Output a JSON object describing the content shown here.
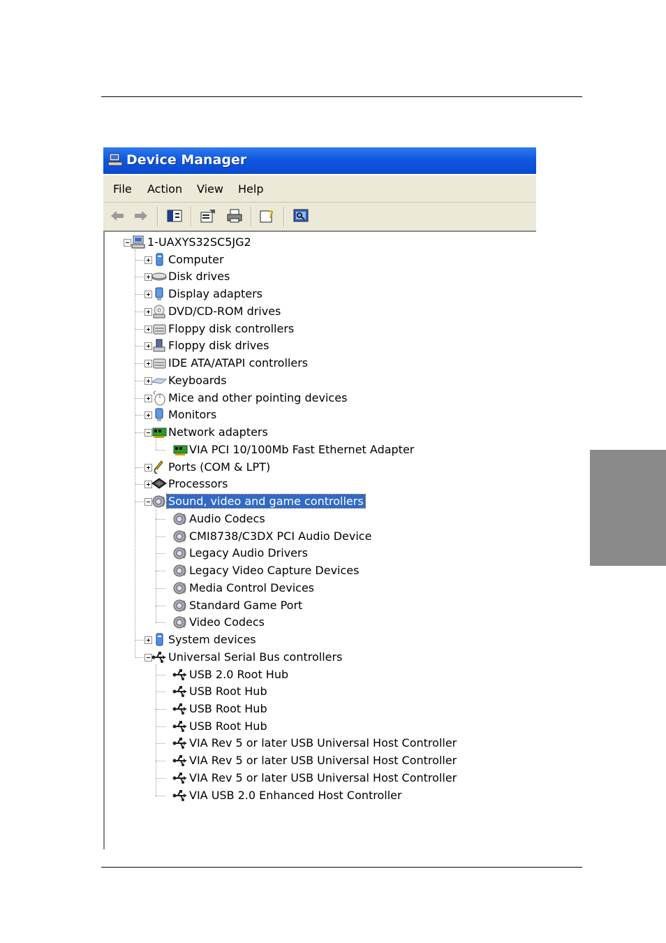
{
  "window": {
    "title": "Device Manager",
    "menu": [
      "File",
      "Action",
      "View",
      "Help"
    ],
    "toolbar_icons": [
      "back-arrow-icon",
      "forward-arrow-icon",
      "show-hide-tree-icon",
      "properties-icon",
      "print-icon",
      "help-icon",
      "scan-hardware-icon"
    ]
  },
  "tree": {
    "root": "1-UAXYS32SC5JG2",
    "categories": [
      {
        "label": "Computer",
        "expanded": false,
        "icon": "computer-icon"
      },
      {
        "label": "Disk drives",
        "expanded": false,
        "icon": "disk-drive-icon"
      },
      {
        "label": "Display adapters",
        "expanded": false,
        "icon": "display-adapter-icon"
      },
      {
        "label": "DVD/CD-ROM drives",
        "expanded": false,
        "icon": "cd-drive-icon"
      },
      {
        "label": "Floppy disk controllers",
        "expanded": false,
        "icon": "controller-icon"
      },
      {
        "label": "Floppy disk drives",
        "expanded": false,
        "icon": "floppy-drive-icon"
      },
      {
        "label": "IDE ATA/ATAPI controllers",
        "expanded": false,
        "icon": "controller-icon"
      },
      {
        "label": "Keyboards",
        "expanded": false,
        "icon": "keyboard-icon"
      },
      {
        "label": "Mice and other pointing devices",
        "expanded": false,
        "icon": "mouse-icon"
      },
      {
        "label": "Monitors",
        "expanded": false,
        "icon": "monitor-icon"
      },
      {
        "label": "Network adapters",
        "expanded": true,
        "icon": "network-card-icon",
        "children": [
          "VIA PCI 10/100Mb Fast Ethernet Adapter"
        ]
      },
      {
        "label": "Ports (COM & LPT)",
        "expanded": false,
        "icon": "port-icon"
      },
      {
        "label": "Processors",
        "expanded": false,
        "icon": "processor-icon"
      },
      {
        "label": "Sound, video and game controllers",
        "expanded": true,
        "selected": true,
        "icon": "speaker-icon",
        "children": [
          "Audio Codecs",
          "CMI8738/C3DX PCI Audio Device",
          "Legacy Audio Drivers",
          "Legacy Video Capture Devices",
          "Media Control Devices",
          "Standard Game Port",
          "Video Codecs"
        ]
      },
      {
        "label": "System devices",
        "expanded": false,
        "icon": "system-device-icon"
      },
      {
        "label": "Universal Serial Bus controllers",
        "expanded": true,
        "icon": "usb-icon",
        "children": [
          "USB 2.0 Root Hub",
          "USB Root Hub",
          "USB Root Hub",
          "USB Root Hub",
          "VIA Rev 5 or later USB Universal Host Controller",
          "VIA Rev 5 or later USB Universal Host Controller",
          "VIA Rev 5 or later USB Universal Host Controller",
          "VIA USB 2.0 Enhanced Host Controller"
        ]
      }
    ]
  },
  "colors": {
    "titlebar": "#0a49d0",
    "selection": "#316ac5",
    "side_tab": "#8a8a8a"
  }
}
